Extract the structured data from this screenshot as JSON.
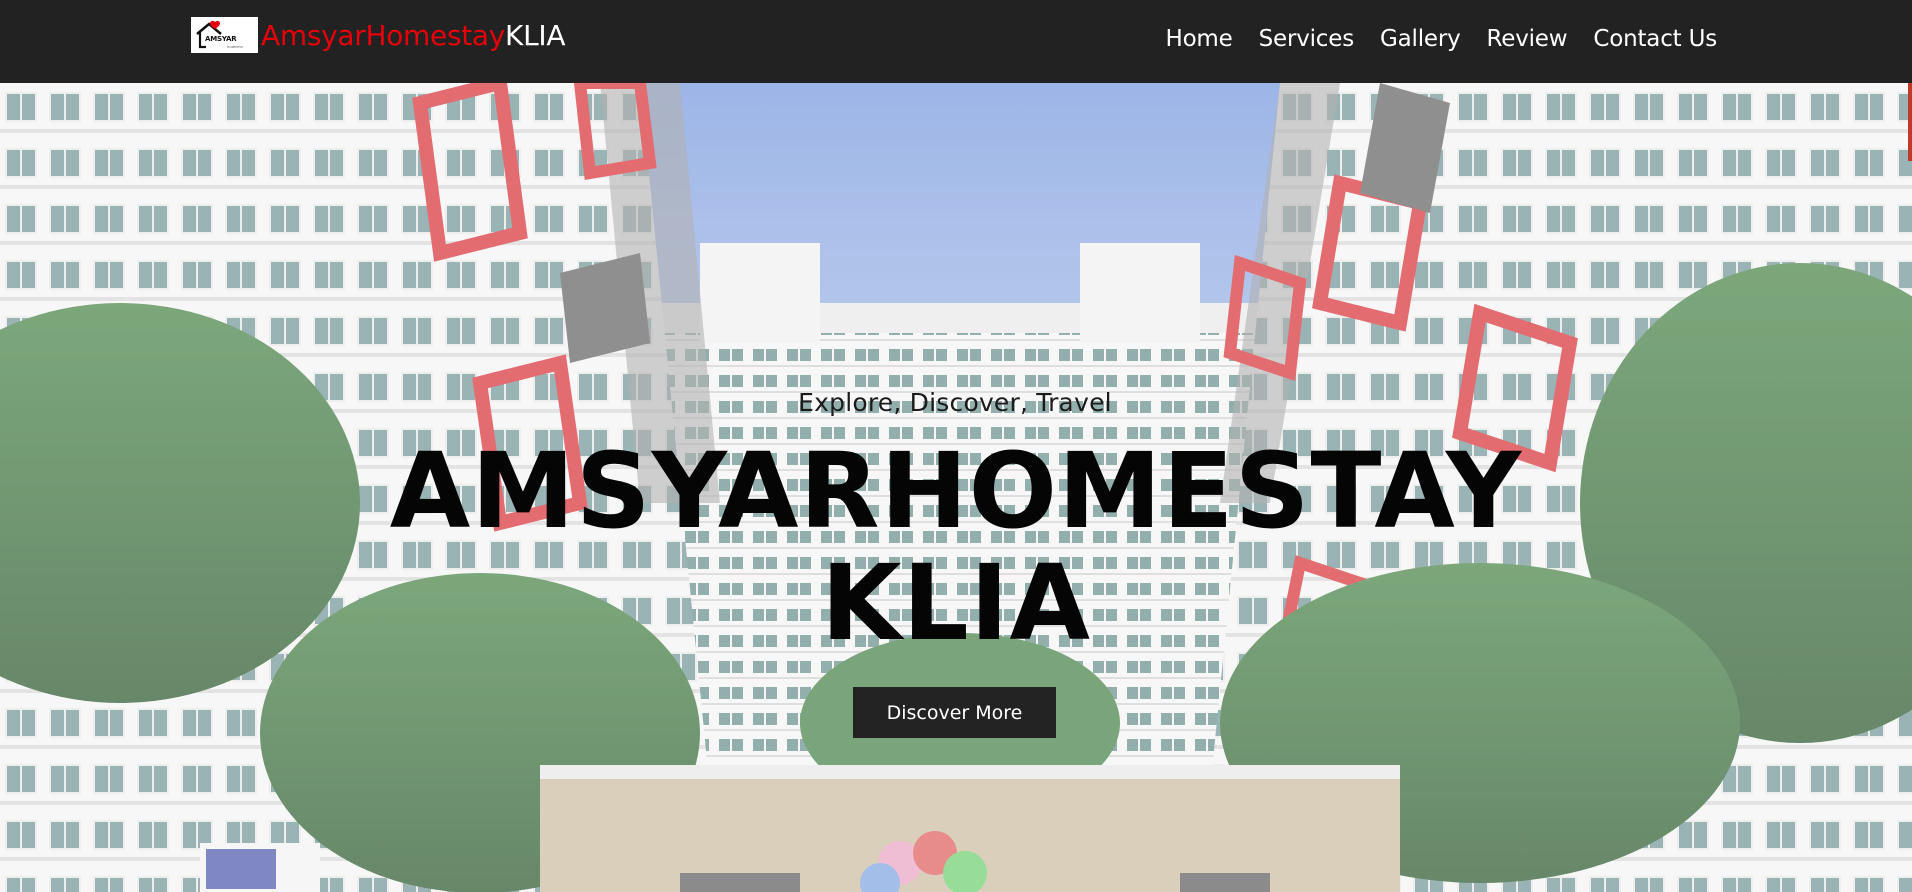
{
  "navbar": {
    "brand": {
      "logo_text": "AMSYAR",
      "logo_sub": "HOMESTAY",
      "red_part": "AmsyarHomestay",
      "white_part": "KLIA"
    },
    "links": [
      {
        "label": "Home"
      },
      {
        "label": "Services"
      },
      {
        "label": "Gallery"
      },
      {
        "label": "Review"
      },
      {
        "label": "Contact Us"
      }
    ]
  },
  "hero": {
    "tagline": "Explore, Discover, Travel",
    "title_line1": "AMSYARHOMESTAY",
    "title_line2": "KLIA",
    "button_label": "Discover More"
  },
  "colors": {
    "navbar_bg": "#222222",
    "brand_red": "#e5000b",
    "button_bg": "#232323",
    "accent_red": "#d6272e"
  }
}
